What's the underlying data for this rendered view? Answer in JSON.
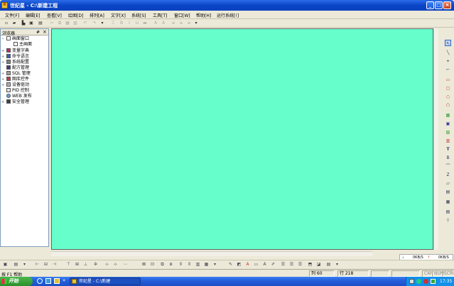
{
  "window": {
    "title": "世纪星 - C:\\新建工程",
    "min": "_",
    "max": "□",
    "close": "×"
  },
  "menu": [
    "文件[F]",
    "编辑[E]",
    "查看[V]",
    "绘图[D]",
    "排列[A]",
    "文字[X]",
    "系统[S]",
    "工具[T]",
    "窗口[W]",
    "帮助[H]",
    "运行系统[!]"
  ],
  "browser": {
    "title": "浏览器",
    "pin": "#",
    "close": "×",
    "items": [
      {
        "label": "画面窗口",
        "color": "#ffffff"
      },
      {
        "label": "主画面",
        "color": "#ffffff"
      },
      {
        "label": "变量字典",
        "color": "#c03060"
      },
      {
        "label": "命令语言",
        "color": "#3060c0"
      },
      {
        "label": "系统配置",
        "color": "#808080"
      },
      {
        "label": "配方管理",
        "color": "#404080"
      },
      {
        "label": "SQL 管理",
        "color": "#a0a0a0"
      },
      {
        "label": "图库控件",
        "color": "#c04040"
      },
      {
        "label": "设备驱动",
        "color": "#b0b0b0"
      },
      {
        "label": "PID 控制",
        "color": "#e0e0e0"
      },
      {
        "label": "WEB 发布",
        "color": "#60a0e0"
      },
      {
        "label": "安全管理",
        "color": "#404040"
      }
    ]
  },
  "canvas": {
    "color": "#66ffcc"
  },
  "network": {
    "down": "0KB/S",
    "up": "0KB/S"
  },
  "status": {
    "help": "按 F1 帮助",
    "col": "列 60",
    "row": "行 218",
    "caps": "CAP",
    "num": "NUM",
    "scrl": "SCRL"
  },
  "taskbar": {
    "start": "开始",
    "task": "世纪星 - C:\\新建",
    "clock": "17:35"
  }
}
